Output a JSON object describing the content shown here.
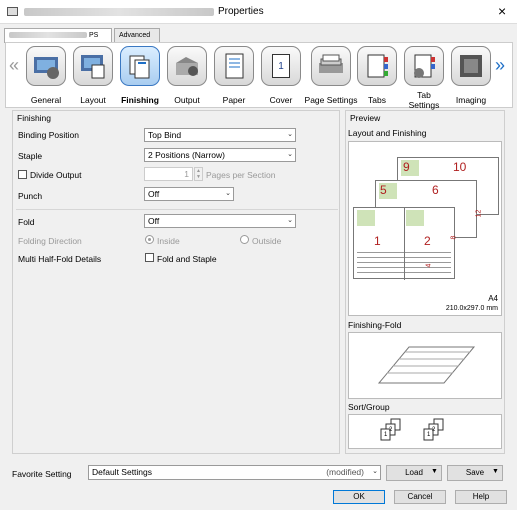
{
  "window": {
    "title": "Properties",
    "close_icon": "×"
  },
  "tabs": [
    "PS",
    "Advanced"
  ],
  "toolbar": {
    "items": [
      "General",
      "Layout",
      "Finishing",
      "Output",
      "Paper",
      "Cover",
      "Page Settings",
      "Tabs",
      "Tab Settings",
      "Imaging"
    ],
    "selected": "Finishing",
    "left_arrow": "«",
    "right_arrow": "»",
    "cover_number": "1"
  },
  "finishing": {
    "group_title": "Finishing",
    "binding_position": {
      "label": "Binding Position",
      "value": "Top Bind"
    },
    "staple": {
      "label": "Staple",
      "value": "2 Positions (Narrow)"
    },
    "divide_output": {
      "label": "Divide Output",
      "value": "1",
      "unit": "Pages per Section"
    },
    "punch": {
      "label": "Punch",
      "value": "Off"
    },
    "fold": {
      "label": "Fold",
      "value": "Off"
    },
    "folding_direction": {
      "label": "Folding Direction",
      "options": [
        "Inside",
        "Outside"
      ]
    },
    "multi_half_fold": {
      "label": "Multi Half-Fold Details",
      "checkbox": "Fold and Staple"
    }
  },
  "preview": {
    "title": "Preview",
    "layout_label": "Layout and Finishing",
    "paper": "A4",
    "paper_size": "210.0x297.0 mm",
    "page_numbers": [
      "1",
      "2",
      "5",
      "6",
      "9",
      "10",
      "4",
      "8",
      "12"
    ],
    "fold_label": "Finishing-Fold",
    "sort_label": "Sort/Group"
  },
  "bottom": {
    "favorite_label": "Favorite Setting",
    "favorite_value": "Default Settings",
    "modified": "(modified)",
    "load": "Load",
    "save": "Save",
    "ok": "OK",
    "cancel": "Cancel",
    "help": "Help"
  }
}
